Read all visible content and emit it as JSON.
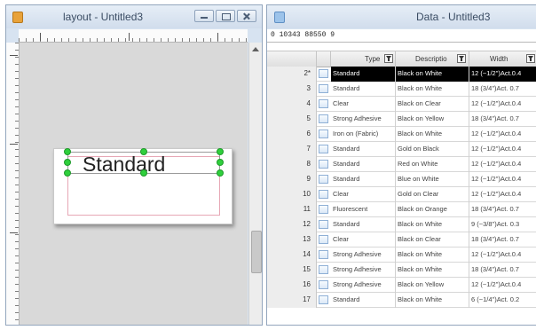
{
  "layout_window": {
    "title": "layout - Untitled3",
    "label_text": "Standard"
  },
  "data_window": {
    "title": "Data - Untitled3",
    "barcode_line": "0 10343 88550 9",
    "columns": [
      "Type",
      "Descriptio",
      "Width"
    ],
    "rows": [
      {
        "num": "2*",
        "type": "Standard",
        "desc": "Black on White",
        "width": "12 (~1/2\")Act.0.4",
        "selected": true
      },
      {
        "num": "3",
        "type": "Standard",
        "desc": "Black on White",
        "width": "18 (3/4\")Act. 0.7"
      },
      {
        "num": "4",
        "type": "Clear",
        "desc": "Black on Clear",
        "width": "12 (~1/2\")Act.0.4"
      },
      {
        "num": "5",
        "type": "Strong Adhesive",
        "desc": "Black on Yellow",
        "width": "18 (3/4\")Act. 0.7"
      },
      {
        "num": "6",
        "type": "Iron on (Fabric)",
        "desc": "Black on White",
        "width": "12 (~1/2\")Act.0.4"
      },
      {
        "num": "7",
        "type": "Standard",
        "desc": "Gold on Black",
        "width": "12 (~1/2\")Act.0.4"
      },
      {
        "num": "8",
        "type": "Standard",
        "desc": "Red on White",
        "width": "12 (~1/2\")Act.0.4"
      },
      {
        "num": "9",
        "type": "Standard",
        "desc": "Blue on White",
        "width": "12 (~1/2\")Act.0.4"
      },
      {
        "num": "10",
        "type": "Clear",
        "desc": "Gold on Clear",
        "width": "12 (~1/2\")Act.0.4"
      },
      {
        "num": "11",
        "type": "Fluorescent",
        "desc": "Black on Orange",
        "width": "18 (3/4\")Act. 0.7"
      },
      {
        "num": "12",
        "type": "Standard",
        "desc": "Black on White",
        "width": "9 (~3/8\")Act. 0.3"
      },
      {
        "num": "13",
        "type": "Clear",
        "desc": "Black on Clear",
        "width": "18 (3/4\")Act. 0.7"
      },
      {
        "num": "14",
        "type": "Strong Adhesive",
        "desc": "Black on White",
        "width": "12 (~1/2\")Act.0.4"
      },
      {
        "num": "15",
        "type": "Strong Adhesive",
        "desc": "Black on White",
        "width": "18 (3/4\")Act. 0.7"
      },
      {
        "num": "16",
        "type": "Strong Adhesive",
        "desc": "Black on Yellow",
        "width": "12 (~1/2\")Act.0.4"
      },
      {
        "num": "17",
        "type": "Standard",
        "desc": "Black on White",
        "width": "6 (~1/4\")Act. 0.2"
      }
    ]
  },
  "colors": {
    "title_bar": "#d7e3f1",
    "handle_green": "#2fcf3c",
    "selection_bg": "#000000",
    "canvas_gray": "#d9d9d9"
  },
  "icons": [
    "app-icon",
    "minimize-icon",
    "maximize-icon",
    "close-icon",
    "filter-icon",
    "scroll-up-icon"
  ]
}
